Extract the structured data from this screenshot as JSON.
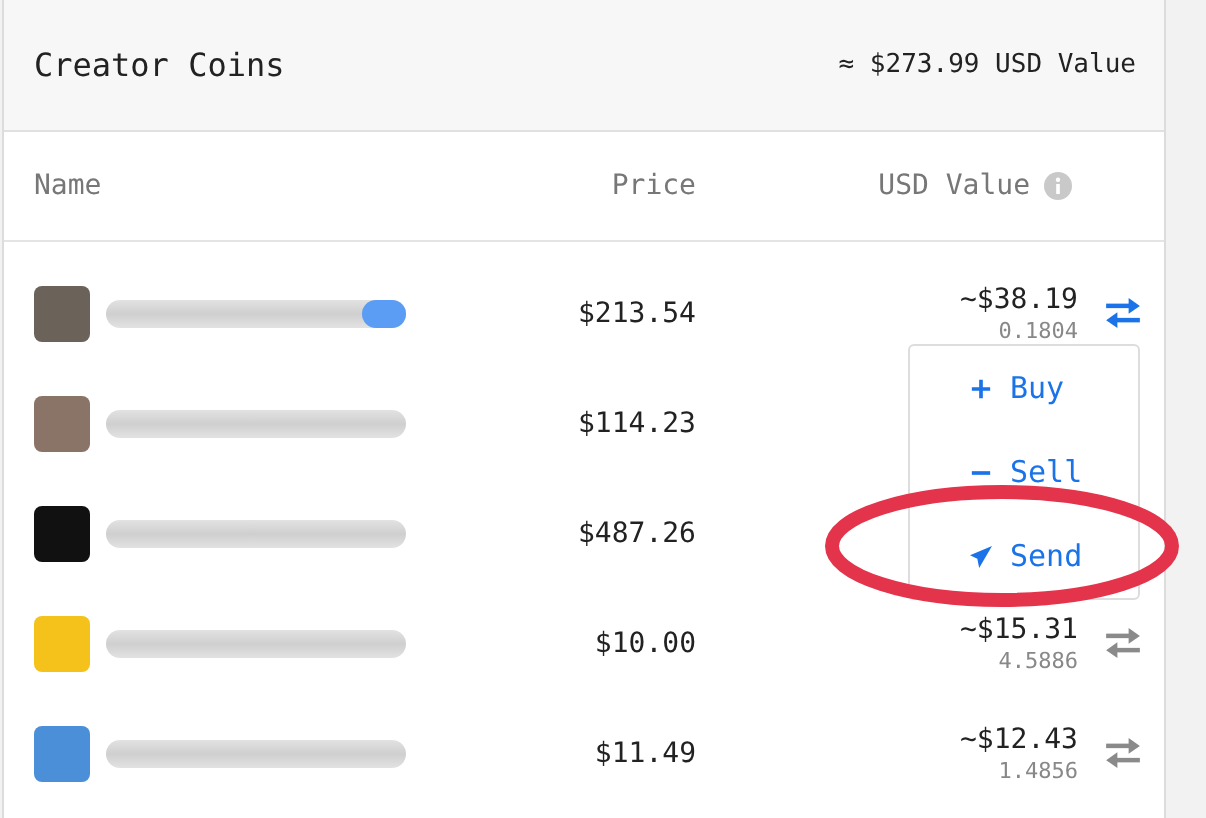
{
  "card": {
    "title": "Creator Coins",
    "total": "≈ $273.99 USD Value"
  },
  "columns": [
    {
      "label": "Name"
    },
    {
      "label": "Price"
    },
    {
      "label": "USD Value",
      "info": true
    }
  ],
  "rows": [
    {
      "avatar": {
        "color": "#6b6259"
      },
      "price": "$213.54",
      "usd_value": "~$38.19",
      "amount": "0.1804",
      "menu_open": true,
      "badge": true
    },
    {
      "avatar": {
        "color": "#8a7468"
      },
      "price": "$114.23",
      "badge": false
    },
    {
      "avatar": {
        "color": "#111111"
      },
      "price": "$487.26",
      "badge": false
    },
    {
      "avatar": {
        "color": "#f4c21b"
      },
      "price": "$10.00",
      "usd_value": "~$15.31",
      "amount": "4.5886",
      "menu_open": false,
      "badge": false
    },
    {
      "avatar": {
        "color": "#4a8fd8"
      },
      "price": "$11.49",
      "usd_value": "~$12.43",
      "amount": "1.4856",
      "menu_open": false,
      "badge": false
    }
  ],
  "menu": [
    {
      "kind": "plus",
      "label": "Buy"
    },
    {
      "kind": "minus",
      "label": "Sell"
    },
    {
      "kind": "send",
      "label": "Send"
    }
  ]
}
